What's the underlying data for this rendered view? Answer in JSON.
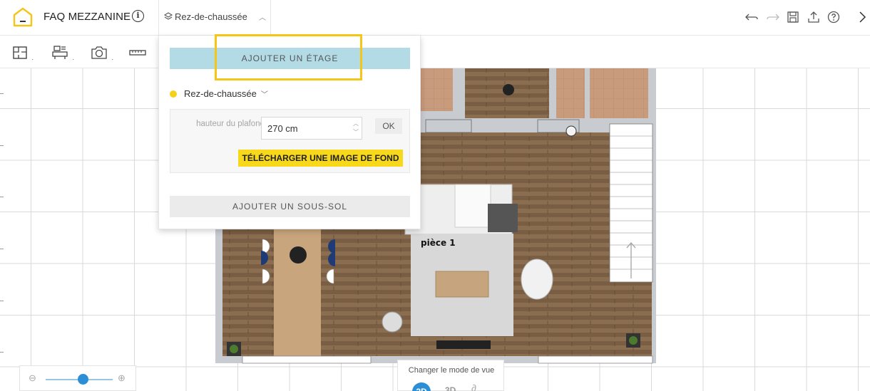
{
  "header": {
    "project_title": "FAQ MEZZANINE",
    "info_symbol": "i",
    "floor_selector_label": "Rez-de-chaussée",
    "icons": [
      "house-logo-icon",
      "info-icon",
      "layers-icon",
      "chevron-up-icon",
      "undo-icon",
      "redo-icon",
      "save-icon",
      "share-icon",
      "help-icon",
      "close-icon"
    ]
  },
  "toolbar": {
    "tools": [
      "room-tool-icon",
      "furniture-tool-icon",
      "camera-tool-icon",
      "ruler-tool-icon"
    ]
  },
  "floor_panel": {
    "add_floor_label": "AJOUTER UN ÉTAGE",
    "current_floor": "Rez-de-chaussée",
    "ceiling_label": "hauteur du plafond",
    "ceiling_value": "270 cm",
    "ok_label": "OK",
    "upload_bg_label": "TÉLÉCHARGER UNE IMAGE DE FOND",
    "add_basement_label": "AJOUTER UN SOUS-SOL",
    "floor_color": "#f5d11a",
    "highlight_color": "#f5c518"
  },
  "plan": {
    "room_label": "pièce 1"
  },
  "zoom": {
    "minus": "⊖",
    "plus": "⊕",
    "level": 0.55
  },
  "view_mode": {
    "caption": "Changer le mode de vue",
    "mode_2d": "2D",
    "mode_3d": "3D",
    "accent": "#2a8fd6"
  }
}
